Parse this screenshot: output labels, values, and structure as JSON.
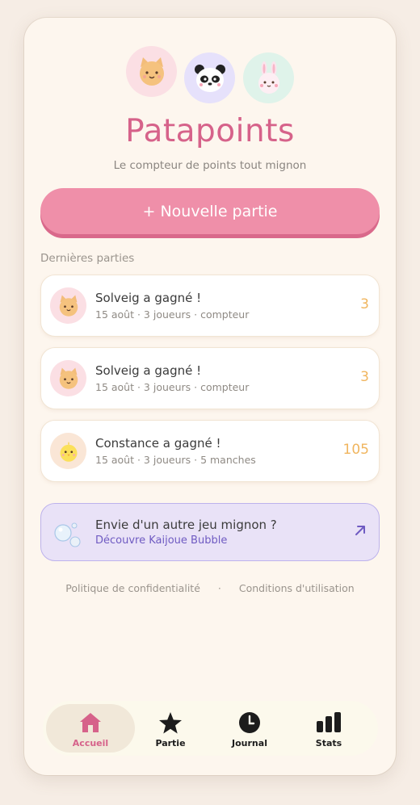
{
  "app": {
    "title": "Patapoints",
    "subtitle": "Le compteur de points tout mignon"
  },
  "header_avatars": [
    {
      "icon": "cat-face-icon",
      "bg": "#fbdfe4"
    },
    {
      "icon": "panda-face-icon",
      "bg": "#e6e1fb"
    },
    {
      "icon": "bunny-face-icon",
      "bg": "#dff3ea"
    }
  ],
  "new_game_label": "+ Nouvelle partie",
  "recent_label": "Dernières parties",
  "games": [
    {
      "title": "Solveig a gagné !",
      "meta": "15 août · 3 joueurs · compteur",
      "score": "3",
      "avatar": "cat-face-icon"
    },
    {
      "title": "Solveig a gagné !",
      "meta": "15 août · 3 joueurs · compteur",
      "score": "3",
      "avatar": "cat-face-icon"
    },
    {
      "title": "Constance a gagné !",
      "meta": "15 août · 3 joueurs · 5 manches",
      "score": "105",
      "avatar": "chick-face-icon"
    }
  ],
  "promo": {
    "title": "Envie d'un autre jeu mignon ?",
    "link": "Découvre Kaijoue Bubble",
    "icon": "bubbles-icon"
  },
  "footer": {
    "privacy": "Politique de confidentialité",
    "separator": "·",
    "terms": "Conditions d'utilisation"
  },
  "tabs": [
    {
      "label": "Accueil",
      "icon": "home-icon",
      "active": true
    },
    {
      "label": "Partie",
      "icon": "star-icon",
      "active": false
    },
    {
      "label": "Journal",
      "icon": "clock-icon",
      "active": false
    },
    {
      "label": "Stats",
      "icon": "bar-chart-icon",
      "active": false
    }
  ],
  "colors": {
    "accent": "#d6628a",
    "button": "#ef8fa9",
    "score": "#f0b55e",
    "promo_link": "#6f5bc2",
    "background": "#fdf6ee"
  }
}
